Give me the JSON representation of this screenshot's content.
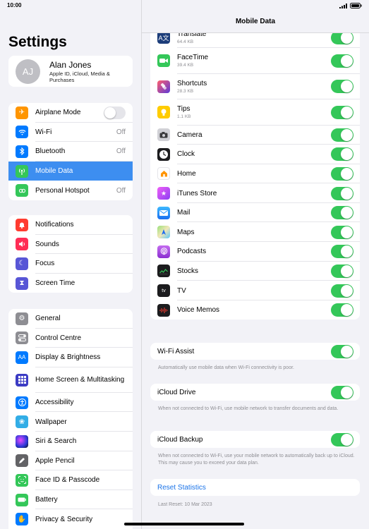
{
  "status": {
    "time": "10:00"
  },
  "sidebar": {
    "title": "Settings",
    "profile": {
      "initials": "AJ",
      "name": "Alan Jones",
      "subtitle": "Apple ID, iCloud, Media & Purchases"
    },
    "group1": [
      {
        "label": "Airplane Mode",
        "icon": "airplane-icon",
        "color": "#ff9500",
        "toggle": false
      },
      {
        "label": "Wi-Fi",
        "icon": "wifi-icon",
        "color": "#007aff",
        "value": "Off"
      },
      {
        "label": "Bluetooth",
        "icon": "bluetooth-icon",
        "color": "#007aff",
        "value": "Off"
      },
      {
        "label": "Mobile Data",
        "icon": "antenna-icon",
        "color": "#34c759",
        "selected": true
      },
      {
        "label": "Personal Hotspot",
        "icon": "hotspot-icon",
        "color": "#34c759",
        "value": "Off"
      }
    ],
    "group2": [
      {
        "label": "Notifications",
        "icon": "bell-icon",
        "color": "#ff3b30"
      },
      {
        "label": "Sounds",
        "icon": "speaker-icon",
        "color": "#ff2d55"
      },
      {
        "label": "Focus",
        "icon": "moon-icon",
        "color": "#5856d6"
      },
      {
        "label": "Screen Time",
        "icon": "hourglass-icon",
        "color": "#5856d6"
      }
    ],
    "group3": [
      {
        "label": "General",
        "icon": "gear-icon",
        "color": "#8e8e93"
      },
      {
        "label": "Control Centre",
        "icon": "switches-icon",
        "color": "#8e8e93"
      },
      {
        "label": "Display & Brightness",
        "icon": "aa-icon",
        "color": "#007aff"
      },
      {
        "label": "Home Screen & Multitasking",
        "icon": "grid-icon",
        "color": "#3c3cc4",
        "tall": true
      },
      {
        "label": "Accessibility",
        "icon": "accessibility-icon",
        "color": "#007aff"
      },
      {
        "label": "Wallpaper",
        "icon": "flower-icon",
        "color": "#32ade6"
      },
      {
        "label": "Siri & Search",
        "icon": "siri-icon",
        "color": "#222222"
      },
      {
        "label": "Apple Pencil",
        "icon": "pencil-icon",
        "color": "#636366"
      },
      {
        "label": "Face ID & Passcode",
        "icon": "faceid-icon",
        "color": "#34c759"
      },
      {
        "label": "Battery",
        "icon": "battery-icon",
        "color": "#34c759"
      },
      {
        "label": "Privacy & Security",
        "icon": "hand-icon",
        "color": "#007aff"
      }
    ]
  },
  "detail": {
    "title": "Mobile Data",
    "apps": [
      {
        "name": "Translate",
        "size": "64.4 KB",
        "icon": "translate-icon",
        "color": "#1c3d7a"
      },
      {
        "name": "FaceTime",
        "size": "39.4 KB",
        "icon": "video-icon",
        "color": "#34c759"
      },
      {
        "name": "Shortcuts",
        "size": "28.3 KB",
        "icon": "shortcuts-icon",
        "color": "#5b3ad8"
      },
      {
        "name": "Tips",
        "size": "1.1 KB",
        "icon": "lightbulb-icon",
        "color": "#ffcc00"
      },
      {
        "name": "Camera",
        "icon": "camera-icon",
        "color": "#8e8e93"
      },
      {
        "name": "Clock",
        "icon": "clock-icon",
        "color": "#1c1c1e"
      },
      {
        "name": "Home",
        "icon": "house-icon",
        "color": "#ff9500"
      },
      {
        "name": "iTunes Store",
        "icon": "star-icon",
        "color": "#c644fc"
      },
      {
        "name": "Mail",
        "icon": "envelope-icon",
        "color": "#1e90ff"
      },
      {
        "name": "Maps",
        "icon": "map-icon",
        "color": "#5ac8fa"
      },
      {
        "name": "Podcasts",
        "icon": "podcast-icon",
        "color": "#9b42d9"
      },
      {
        "name": "Stocks",
        "icon": "chart-icon",
        "color": "#1c1c1e"
      },
      {
        "name": "TV",
        "icon": "appletv-icon",
        "color": "#1c1c1e"
      },
      {
        "name": "Voice Memos",
        "icon": "waveform-icon",
        "color": "#1c1c1e"
      }
    ],
    "wifi_assist": {
      "label": "Wi-Fi Assist",
      "note": "Automatically use mobile data when Wi-Fi connectivity is poor."
    },
    "icloud_drive": {
      "label": "iCloud Drive",
      "note": "When not connected to Wi-Fi, use mobile network to transfer documents and data."
    },
    "icloud_backup": {
      "label": "iCloud Backup",
      "note": "When not connected to Wi-Fi, use your mobile network to automatically back up to iCloud. This may cause you to exceed your data plan."
    },
    "reset": {
      "label": "Reset Statistics",
      "last_reset": "Last Reset: 10 Mar 2023"
    }
  },
  "colors": {
    "accent": "#007aff",
    "toggle_on": "#34c759",
    "selected_row": "#3d8ef0"
  }
}
